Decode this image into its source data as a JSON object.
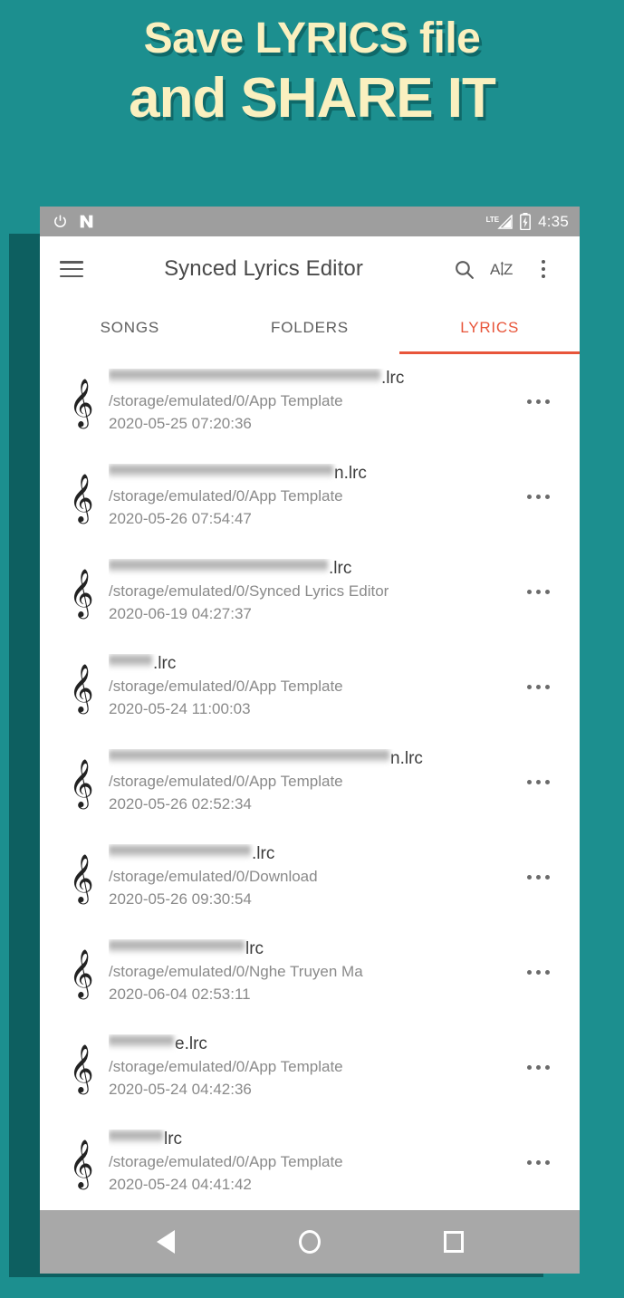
{
  "promo": {
    "line1": "Save LYRICS file",
    "line2": "and SHARE IT",
    "bg_color": "#1c8f8f",
    "text_color": "#faf0bf"
  },
  "status_bar": {
    "power_icon": "power-icon",
    "nova_icon": "nova-launcher-icon",
    "network_label": "LTE",
    "signal_icon": "signal-bars-icon",
    "battery_icon": "battery-charging-icon",
    "time": "4:35"
  },
  "toolbar": {
    "menu_icon": "hamburger-menu-icon",
    "title": "Synced Lyrics Editor",
    "search_icon": "search-icon",
    "sort_icon": "sort-alphabetical-icon",
    "sort_label_a": "A",
    "sort_label_z": "Z",
    "overflow_icon": "more-vertical-icon"
  },
  "tabs": [
    {
      "label": "SONGS",
      "active": false
    },
    {
      "label": "FOLDERS",
      "active": false
    },
    {
      "label": "LYRICS",
      "active": true
    }
  ],
  "accent_color": "#e8553a",
  "list": {
    "item_icon": "treble-clef-icon",
    "item_overflow_icon": "more-horizontal-icon",
    "items": [
      {
        "name_redacted_width": 300,
        "name_suffix": ".lrc",
        "path": "/storage/emulated/0/App Template",
        "date": "2020-05-25 07:20:36"
      },
      {
        "name_redacted_width": 248,
        "name_suffix": "n.lrc",
        "path": "/storage/emulated/0/App Template",
        "date": "2020-05-26 07:54:47"
      },
      {
        "name_redacted_width": 242,
        "name_suffix": ".lrc",
        "path": "/storage/emulated/0/Synced Lyrics Editor",
        "date": "2020-06-19 04:27:37"
      },
      {
        "name_redacted_width": 48,
        "name_suffix": ".lrc",
        "path": "/storage/emulated/0/App Template",
        "date": "2020-05-24 11:00:03"
      },
      {
        "name_redacted_width": 310,
        "name_suffix": "n.lrc",
        "path": "/storage/emulated/0/App Template",
        "date": "2020-05-26 02:52:34"
      },
      {
        "name_redacted_width": 157,
        "name_suffix": ".lrc",
        "path": "/storage/emulated/0/Download",
        "date": "2020-05-26 09:30:54"
      },
      {
        "name_redacted_width": 150,
        "name_suffix": "lrc",
        "path": "/storage/emulated/0/Nghe Truyen Ma",
        "date": "2020-06-04 02:53:11"
      },
      {
        "name_redacted_width": 72,
        "name_suffix": "e.lrc",
        "path": "/storage/emulated/0/App Template",
        "date": "2020-05-24 04:42:36"
      },
      {
        "name_redacted_width": 60,
        "name_suffix": "lrc",
        "path": "/storage/emulated/0/App Template",
        "date": "2020-05-24 04:41:42"
      }
    ]
  },
  "nav_bar": {
    "back_icon": "back-triangle-icon",
    "home_icon": "home-circle-icon",
    "recents_icon": "recents-square-icon"
  }
}
